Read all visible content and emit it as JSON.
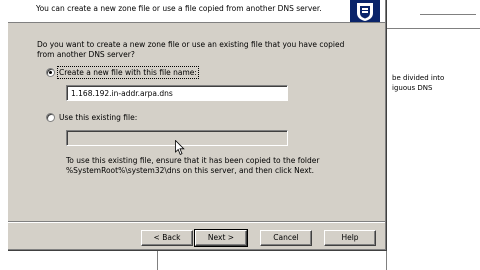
{
  "background": {
    "right_text_line1": "be divided into",
    "right_text_line2": "iguous DNS"
  },
  "wizard": {
    "header_subtitle": "You can create a new zone file or use a file copied from another DNS server.",
    "question": "Do you want to create a new zone file or use an existing file that you have copied from another DNS server?",
    "options": [
      {
        "label": "Create a new file with this file name:",
        "selected": true
      },
      {
        "label": "Use this existing file:",
        "selected": false
      }
    ],
    "new_file_value": "1.168.192.in-addr.arpa.dns",
    "existing_file_value": "",
    "note": "To use this existing file, ensure that it has been copied to the folder %SystemRoot%\\system32\\dns on this server, and then click Next."
  },
  "buttons": {
    "back": "< Back",
    "next": "Next >",
    "cancel": "Cancel",
    "help": "Help"
  },
  "icons": {
    "logo": "dns-wizard-icon",
    "cursor": "mouse-pointer-icon"
  }
}
